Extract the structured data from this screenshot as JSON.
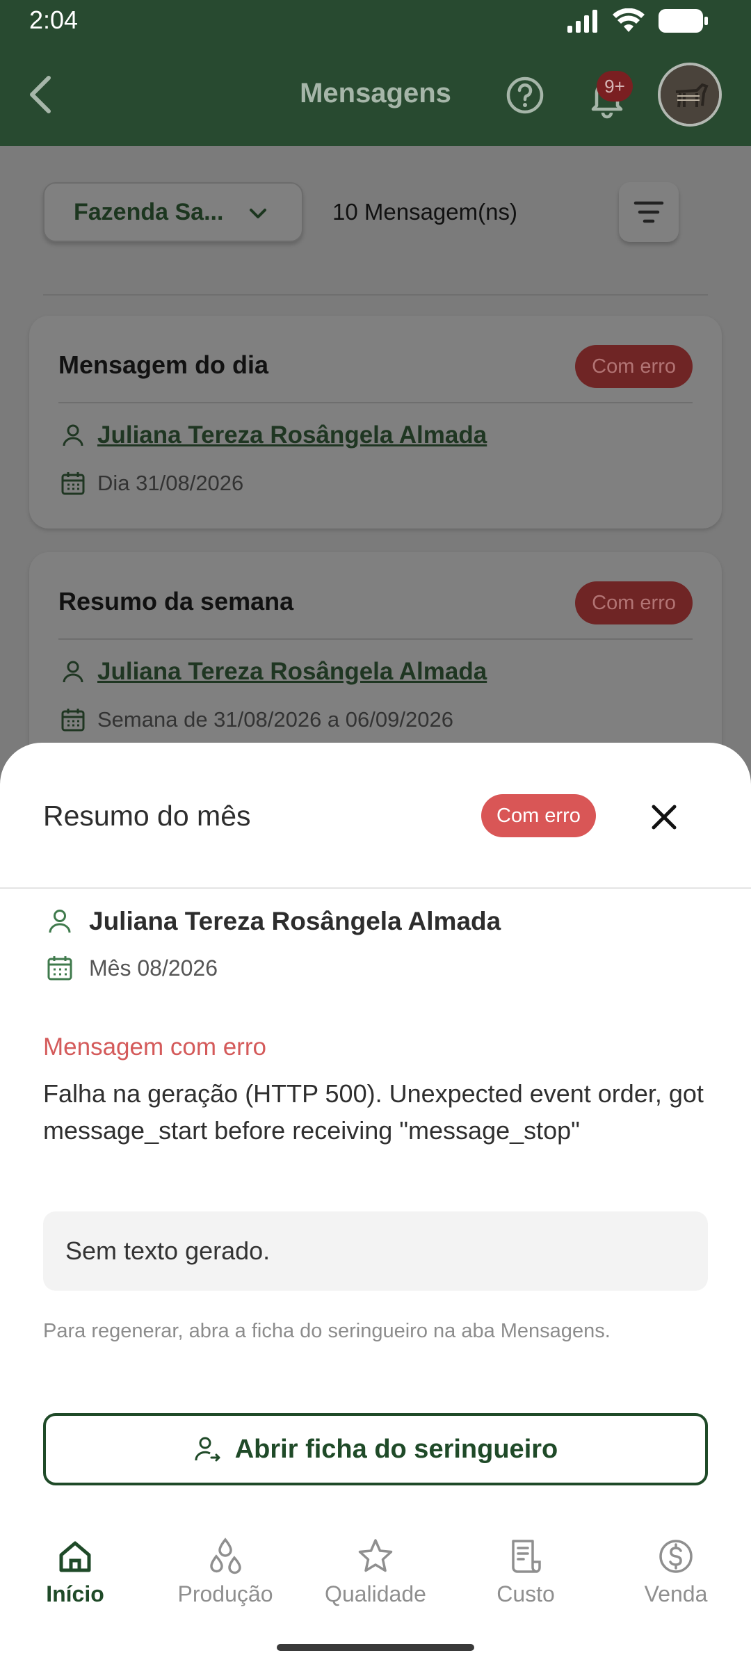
{
  "status_bar": {
    "time": "2:04"
  },
  "header": {
    "title": "Mensagens",
    "notification_badge": "9+"
  },
  "toolbar": {
    "farm_select": "Fazenda Sa...",
    "message_count": "10 Mensagem(ns)"
  },
  "cards": [
    {
      "title": "Mensagem do dia",
      "status": "Com erro",
      "person": "Juliana Tereza Rosângela Almada",
      "date": "Dia 31/08/2026"
    },
    {
      "title": "Resumo da semana",
      "status": "Com erro",
      "person": "Juliana Tereza Rosângela Almada",
      "date": "Semana de 31/08/2026 a 06/09/2026"
    }
  ],
  "sheet": {
    "title": "Resumo do mês",
    "status": "Com erro",
    "person": "Juliana Tereza Rosângela Almada",
    "month": "Mês 08/2026",
    "error_heading": "Mensagem com erro",
    "error_text": "Falha na geração (HTTP 500). Unexpected event order, got message_start before receiving \"message_stop\"",
    "generated_text": "Sem texto gerado.",
    "hint": "Para regenerar, abra a ficha do seringueiro na aba Mensagens.",
    "open_button": "Abrir ficha do seringueiro"
  },
  "nav": [
    {
      "label": "Início",
      "icon": "home-icon",
      "active": true
    },
    {
      "label": "Produção",
      "icon": "drops-icon",
      "active": false
    },
    {
      "label": "Qualidade",
      "icon": "star-icon",
      "active": false
    },
    {
      "label": "Custo",
      "icon": "receipt-icon",
      "active": false
    },
    {
      "label": "Venda",
      "icon": "dollar-icon",
      "active": false
    }
  ],
  "colors": {
    "header_bg": "#284a30",
    "accent_green": "#1f4a28",
    "error_red": "#d95656"
  }
}
